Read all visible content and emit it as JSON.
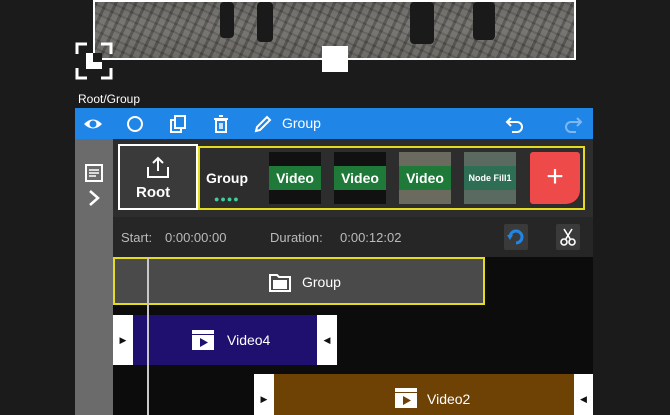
{
  "breadcrumb": "Root/Group",
  "toolbar": {
    "items": [
      "eye-icon",
      "circle-icon",
      "copy-icon",
      "trash-icon",
      "pencil-icon"
    ],
    "label": "Group",
    "undo": "undo-icon",
    "redo": "redo-icon",
    "background": "#1f86e8"
  },
  "nodes": {
    "root_label": "Root",
    "group_label": "Group",
    "group_dots": "●●●●",
    "thumbs": [
      "Video",
      "Video",
      "Video",
      "Node Fill1"
    ],
    "add_label": "+"
  },
  "time": {
    "start_label": "Start:",
    "start_value": "0:00:00:00",
    "duration_label": "Duration:",
    "duration_value": "0:00:12:02"
  },
  "timeline": {
    "tracks": [
      {
        "label": "Group",
        "color": "#4a4a4a"
      },
      {
        "label": "Video4",
        "color": "#1f0f6e"
      },
      {
        "label": "Video2",
        "color": "#6e4105"
      }
    ],
    "highlight": "#e4dc20"
  }
}
